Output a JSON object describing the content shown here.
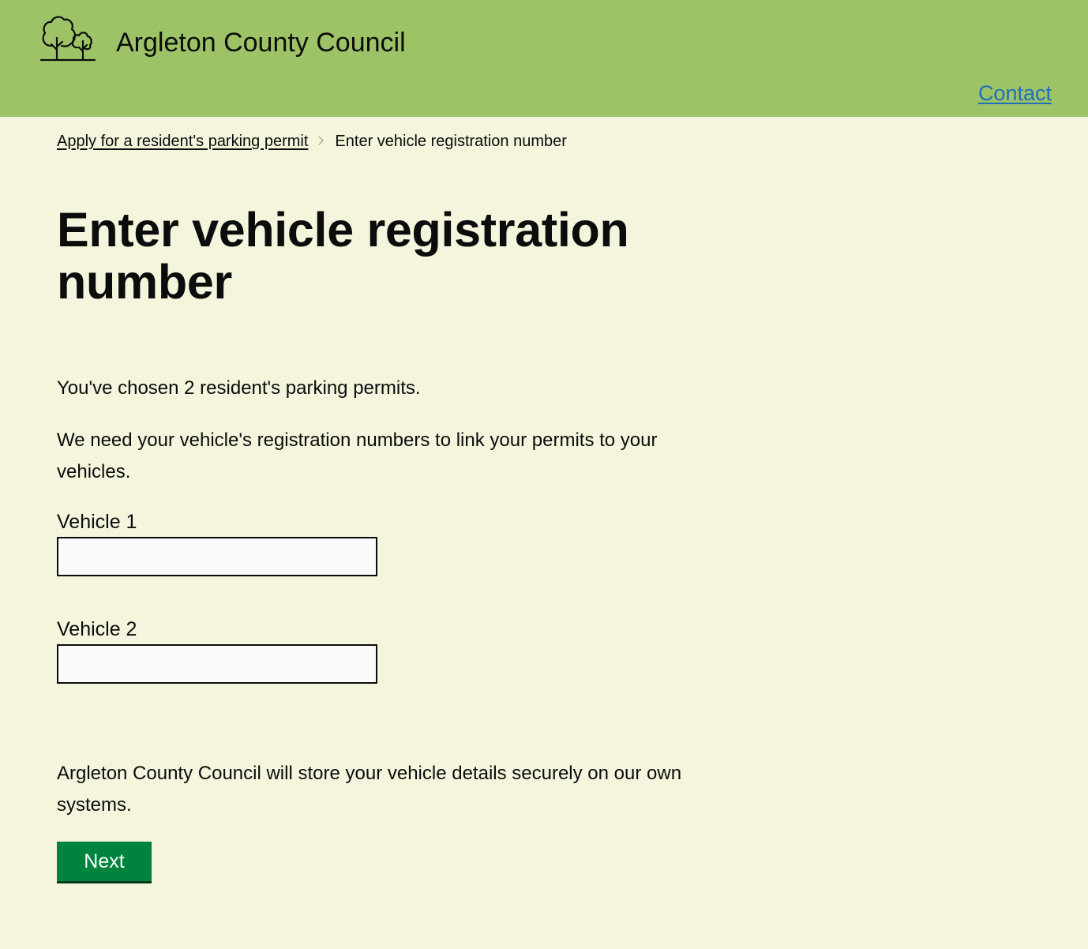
{
  "header": {
    "site_name": "Argleton County Council",
    "logo_icon": "trees-logo-icon",
    "contact_label": "Contact",
    "background_color": "#9dc366"
  },
  "breadcrumb": {
    "parent_label": "Apply for a resident's parking permit",
    "separator_icon": "chevron-right-icon",
    "current_label": "Enter vehicle registration number"
  },
  "main": {
    "title": "Enter vehicle registration number",
    "intro": "You've chosen 2 resident's parking permits.",
    "explanation": "We need your vehicle's registration numbers to link your permits to your vehicles.",
    "vehicles": [
      {
        "label": "Vehicle 1",
        "value": ""
      },
      {
        "label": "Vehicle 2",
        "value": ""
      }
    ],
    "storage_notice": "Argleton County Council will store your vehicle details securely on our own systems.",
    "next_label": "Next",
    "button_color": "#00843d",
    "link_color": "#1d70b8"
  }
}
